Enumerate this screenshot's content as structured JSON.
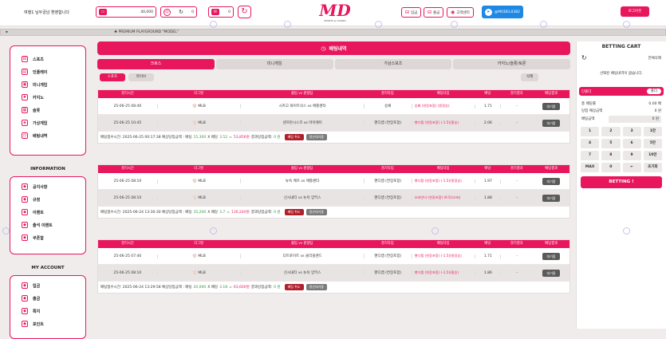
{
  "header": {
    "welcome": "여행1 님두궁남 환영합니다",
    "money": "40,000",
    "points": "0",
    "messages": "0",
    "deposit": "입금",
    "withdraw": "출금",
    "support": "고객센터",
    "telegram": "@MODEL0382",
    "login": "로그아웃",
    "logo_main": "MD",
    "logo_sub": "SPORTS & CASINO"
  },
  "marquee": {
    "speaker": "🕪",
    "text": "♣ PREMIUM PLAYGROUND \"MODEL\""
  },
  "sidebar": {
    "main_items": [
      "스포츠",
      "인플레이",
      "미니게임",
      "카지노",
      "슬롯",
      "가상게임",
      "배팅내역"
    ],
    "info_title": "INFORMATION",
    "info_items": [
      "공지사항",
      "규정",
      "이벤트",
      "출석 이벤트",
      "쿠폰함"
    ],
    "account_title": "MY ACCOUNT",
    "account_items": [
      "입금",
      "출금",
      "쪽지",
      "포인트"
    ]
  },
  "main": {
    "title": "배팅내역",
    "tabs": [
      "크로스",
      "미니게임",
      "가상스포츠",
      "카지노/슬롯/토론"
    ],
    "sub_tabs": [
      "스포츠",
      "라이브"
    ],
    "delete_label": "삭제"
  },
  "bet_columns": [
    "경기시간",
    "리그명",
    "홈팀 vs 원정팀",
    "경기타입",
    "배팅타입",
    "배당",
    "경기결과",
    "배팅결과"
  ],
  "bets": [
    {
      "rows": [
        {
          "time": "25-06-25 08:40",
          "league": "MLB",
          "teams": "시카고 화이트삭스 vs 애틀랜타",
          "type": "승패",
          "pick": "승패 (연장포함) (원정승)",
          "odds": "1.71",
          "result": "-",
          "status": "대기중"
        },
        {
          "time": "25-06-25 10:45",
          "league": "MLB",
          "teams": "샌프란시스코 vs 마이애미",
          "type": "핸디캡 (연장포함)",
          "pick": "핸디캡 (연장포함) (-1.5)(홈승)",
          "odds": "2.06",
          "result": "-",
          "status": "대기중"
        }
      ],
      "footer": {
        "label": "배팅접수시간: 2025-06-25 00:17:38  예상당첨금액 : 배팅",
        "stake": "15,300",
        "mid": "X 배당",
        "odds": "3.52",
        "eq": "=",
        "win": "53,856원",
        "res": "결과당첨금액:",
        "res_val": "0 원",
        "cancel": "배팅 취소",
        "fix": "정산대기중"
      }
    },
    {
      "rows": [
        {
          "time": "25-06-25 08:10",
          "league": "MLB",
          "teams": "뉴욕 메츠 vs 애틀랜타",
          "type": "핸디캡 (연장포함)",
          "pick": "핸디캡 (연장포함) (-1.5)(원정승)",
          "odds": "1.97",
          "result": "-",
          "status": "대기중"
        },
        {
          "time": "25-06-25 08:10",
          "league": "MLB",
          "teams": "신시내티 vs 뉴욕 양키스",
          "type": "핸디캡 (연장포함)",
          "pick": "오버언더 (연장포함) (9.5)(오버)",
          "odds": "1.88",
          "result": "-",
          "status": "대기중"
        }
      ],
      "footer": {
        "label": "배팅접수시간: 2025-06-24 13:30:30  예상당첨금액 : 배팅",
        "stake": "35,200",
        "mid": "X 배당",
        "odds": "3.7",
        "eq": "=",
        "win": "130,240원",
        "res": "결과당첨금액:",
        "res_val": "0 원",
        "cancel": "배팅 취소",
        "fix": "정산대기중"
      }
    },
    {
      "rows": [
        {
          "time": "25-06-25 07:40",
          "league": "MLB",
          "teams": "디트로이트 vs 클리블랜드",
          "type": "핸디캡 (연장포함)",
          "pick": "핸디캡 (연장포함) (-1.5)(원정승)",
          "odds": "1.71",
          "result": "-",
          "status": "대기중"
        },
        {
          "time": "25-06-25 08:10",
          "league": "MLB",
          "teams": "신시내티 vs 뉴욕 양키스",
          "type": "핸디캡 (연장포함)",
          "pick": "핸디캡 (연장포함) (-1.5)(홈승)",
          "odds": "1.86",
          "result": "-",
          "status": "대기중"
        }
      ],
      "footer": {
        "label": "배팅접수시간: 2025-06-24 13:29:58  예상당첨금액 : 배팅",
        "stake": "20,000",
        "mid": "X 배당",
        "odds": "3.18",
        "eq": "=",
        "win": "63,600원",
        "res": "결과당첨금액:",
        "res_val": "0 원",
        "cancel": "배팅 취소",
        "fix": "정산대기중"
      }
    }
  ],
  "cart": {
    "title": "BETTING CART",
    "clear_all": "전체삭제",
    "empty": "선택된 배팅내역이 없습니다.",
    "single": "단폴더",
    "multi": "폴더",
    "odds_label": "총 배당률",
    "odds_val": "0.00 배",
    "win_label": "당첨 예상금액",
    "win_val": "0 원",
    "amount_label": "배팅금액",
    "amount_val": "0 원",
    "keys": [
      "1",
      "2",
      "3",
      "1만",
      "4",
      "5",
      "6",
      "5만",
      "7",
      "8",
      "9",
      "10만",
      "MAX",
      "0",
      "←",
      "초기화"
    ],
    "bet_button": "BETTING !"
  },
  "colors": {
    "accent": "#e8175d",
    "telegram": "#1e88e5"
  }
}
